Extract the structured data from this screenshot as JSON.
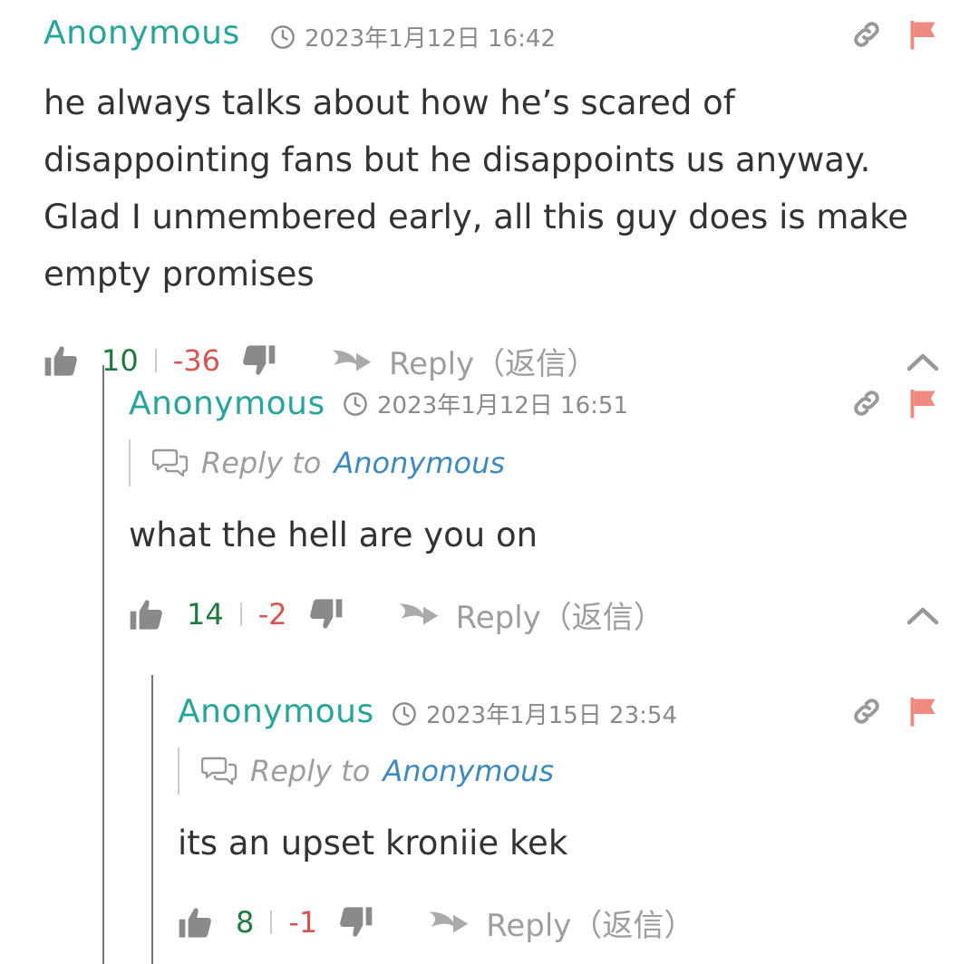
{
  "comments": [
    {
      "author": "Anonymous",
      "date": "2023年1月12日 16:42",
      "body": "he always talks about how he’s scared of disappointing fans but he disappoints us anyway. Glad I unmembered early, all this guy does is make empty promises",
      "upvotes": "10",
      "downvotes": "-36",
      "reply_label": "Reply（返信）"
    },
    {
      "author": "Anonymous",
      "date": "2023年1月12日 16:51",
      "reply_to_label": "Reply to",
      "reply_to_name": "Anonymous",
      "body": "what the hell are you on",
      "upvotes": "14",
      "downvotes": "-2",
      "reply_label": "Reply（返信）"
    },
    {
      "author": "Anonymous",
      "date": "2023年1月15日 23:54",
      "reply_to_label": "Reply to",
      "reply_to_name": "Anonymous",
      "body": "its an upset kroniie kek",
      "upvotes": "8",
      "downvotes": "-1",
      "reply_label": "Reply（返信）"
    }
  ],
  "icons": {
    "clock": "clock-icon",
    "link": "link-icon",
    "flag": "flag-icon",
    "thumb_up": "thumbs-up-icon",
    "thumb_down": "thumbs-down-icon",
    "reply": "reply-arrow-icon",
    "collapse": "chevron-up-icon",
    "reply_to": "speech-bubbles-icon"
  },
  "colors": {
    "author": "#26a69a",
    "upvote": "#1e7a3c",
    "downvote": "#d9534f",
    "flag": "#ef8a80",
    "reply_to_name": "#3d8ac0",
    "muted": "#9e9e9e"
  }
}
